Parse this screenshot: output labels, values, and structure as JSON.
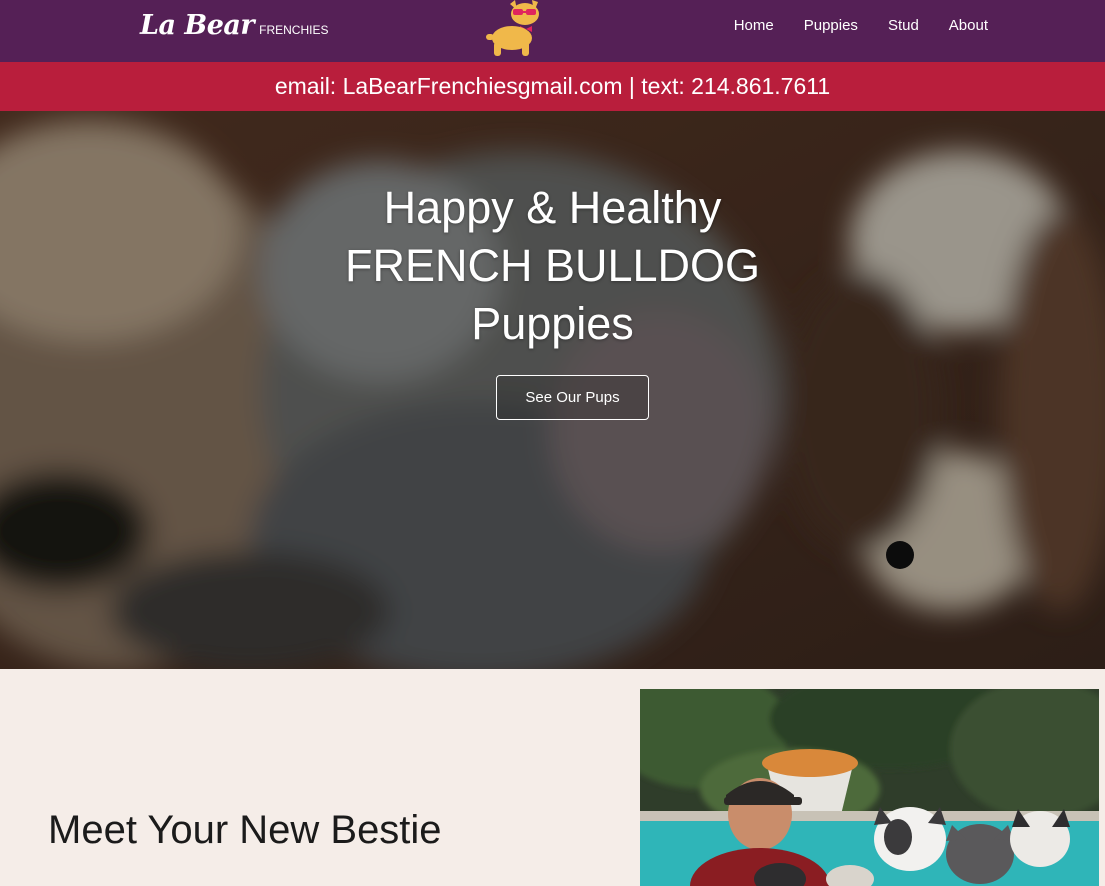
{
  "header": {
    "logo_script": "La Bear",
    "logo_sub": "FRENCHIES",
    "mascot_icon": "french-bulldog-mascot-icon",
    "nav": [
      {
        "label": "Home"
      },
      {
        "label": "Puppies"
      },
      {
        "label": "Stud"
      },
      {
        "label": "About"
      }
    ]
  },
  "contact_bar": {
    "text": "email: LaBearFrenchiesgmail.com | text: 214.861.7611"
  },
  "hero": {
    "title_line1": "Happy & Healthy",
    "title_line2": "FRENCH BULLDOG",
    "title_line3": "Puppies",
    "cta_label": "See Our Pups"
  },
  "section": {
    "heading": "Meet Your New Bestie"
  },
  "colors": {
    "header_bg": "#552056",
    "contact_bg": "#b91e3c",
    "section_bg": "#f5ede8",
    "mascot": "#f0b84a"
  }
}
